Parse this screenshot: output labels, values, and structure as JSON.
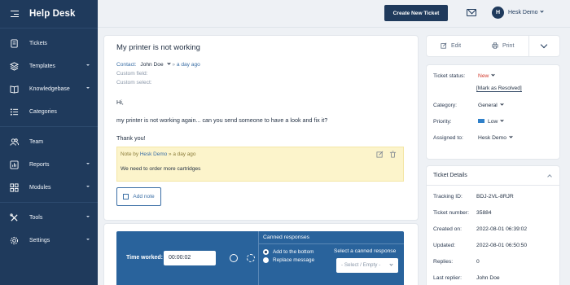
{
  "app": {
    "title": "Help Desk"
  },
  "sidebar": {
    "items": [
      {
        "label": "Tickets",
        "icon": "ticket-icon",
        "has_caret": false
      },
      {
        "label": "Templates",
        "icon": "layers-icon",
        "has_caret": true
      },
      {
        "label": "Knowledgebase",
        "icon": "book-icon",
        "has_caret": true
      },
      {
        "label": "Categories",
        "icon": "list-icon",
        "has_caret": false
      },
      {
        "label": "Team",
        "icon": "users-icon",
        "has_caret": false
      },
      {
        "label": "Reports",
        "icon": "chart-icon",
        "has_caret": true
      },
      {
        "label": "Modules",
        "icon": "grid-icon",
        "has_caret": true
      },
      {
        "label": "Tools",
        "icon": "tools-icon",
        "has_caret": true
      },
      {
        "label": "Settings",
        "icon": "gear-icon",
        "has_caret": true
      }
    ]
  },
  "topbar": {
    "create_label": "Create New Ticket",
    "avatar_initial": "H",
    "user_name": "Hesk Demo"
  },
  "ticket": {
    "subject": "My printer is not working",
    "contact_label": "Contact:",
    "contact_name": "John Doe",
    "contact_ago": "a day ago",
    "custom_field": "Custom field:",
    "custom_select": "Custom select:",
    "body": [
      "Hi,",
      "my printer is not working again... can you send someone to have a look and fix it?",
      "Thank you!"
    ],
    "note": {
      "prefix": "Note by",
      "author": "Hesk Demo",
      "ago": "» a day ago",
      "text": "We need to order more cartridges"
    },
    "add_note_label": "Add note"
  },
  "reply": {
    "time_worked_label": "Time worked:",
    "time_worked_value": "00:00:02",
    "canned_heading": "Canned responses",
    "option_add": "Add to the bottom",
    "option_replace": "Replace message",
    "select_label": "Select a canned response",
    "select_value": "- Select / Empty -"
  },
  "actions": {
    "edit_label": "Edit",
    "print_label": "Print"
  },
  "status": {
    "status_label": "Ticket status:",
    "status_value": "New",
    "mark_resolved": "[Mark as Resolved]",
    "category_label": "Category:",
    "category_value": "General",
    "priority_label": "Priority:",
    "priority_value": "Low",
    "assigned_label": "Assigned to:",
    "assigned_value": "Hesk Demo"
  },
  "details": {
    "heading": "Ticket Details",
    "rows": [
      {
        "label": "Tracking ID:",
        "value": "BDJ-2VL-8RJR"
      },
      {
        "label": "Ticket number:",
        "value": "35884"
      },
      {
        "label": "Created on:",
        "value": "2022-08-01 06:39:02"
      },
      {
        "label": "Updated:",
        "value": "2022-08-01 06:50:50"
      },
      {
        "label": "Replies:",
        "value": "0"
      },
      {
        "label": "Last replier:",
        "value": "John Doe"
      }
    ]
  },
  "colors": {
    "sidebar": "#1f3a5c",
    "accent": "#29639c",
    "status_new": "#d23a2d",
    "note_bg": "#fcf4cb"
  }
}
